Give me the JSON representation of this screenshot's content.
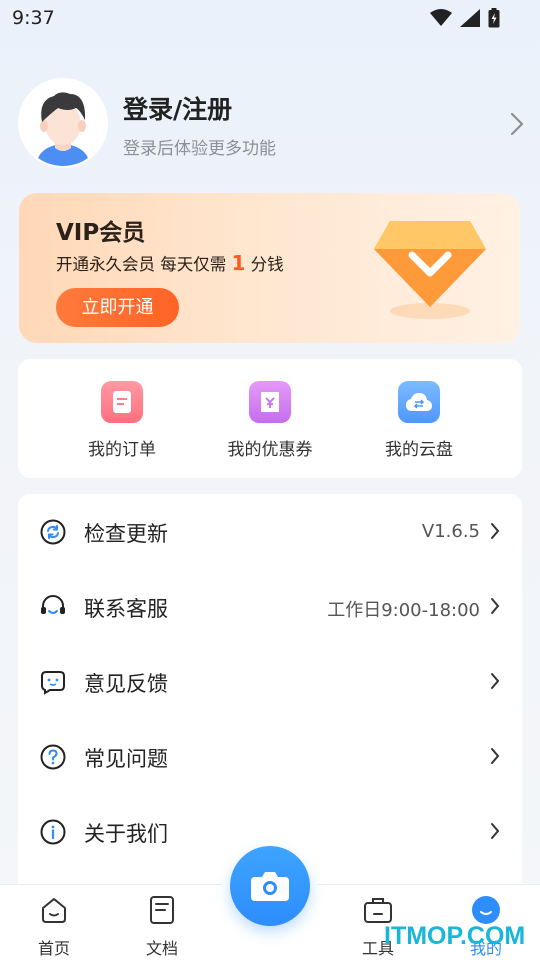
{
  "status_bar": {
    "time": "9:37",
    "icons": [
      "wifi-icon",
      "signal-icon",
      "battery-icon"
    ]
  },
  "profile": {
    "title": "登录/注册",
    "subtitle": "登录后体验更多功能"
  },
  "vip": {
    "title": "VIP会员",
    "desc_before": "开通永久会员 每天仅需 ",
    "desc_number": "1",
    "desc_after": " 分钱",
    "button": "立即开通",
    "accent": "#ff6326"
  },
  "quick": [
    {
      "label": "我的订单",
      "icon": "order-icon",
      "color": "#ff7d8a"
    },
    {
      "label": "我的优惠券",
      "icon": "coupon-icon",
      "color": "#d57bf2"
    },
    {
      "label": "我的云盘",
      "icon": "cloud-icon",
      "color": "#5aa6ff"
    }
  ],
  "menu": [
    {
      "label": "检查更新",
      "value": "V1.6.5",
      "icon": "refresh-icon"
    },
    {
      "label": "联系客服",
      "value": "工作日9:00-18:00",
      "icon": "headset-icon"
    },
    {
      "label": "意见反馈",
      "value": "",
      "icon": "feedback-icon"
    },
    {
      "label": "常见问题",
      "value": "",
      "icon": "question-icon"
    },
    {
      "label": "关于我们",
      "value": "",
      "icon": "info-icon"
    }
  ],
  "tabs": [
    {
      "label": "首页",
      "icon": "home-icon"
    },
    {
      "label": "文档",
      "icon": "document-icon"
    },
    {
      "label": "工具",
      "icon": "toolbox-icon"
    },
    {
      "label": "我的",
      "icon": "profile-icon",
      "active": true
    }
  ],
  "watermark": "ITMOP.COM",
  "colors": {
    "primary": "#2d8dfd",
    "accent": "#ff6326"
  }
}
